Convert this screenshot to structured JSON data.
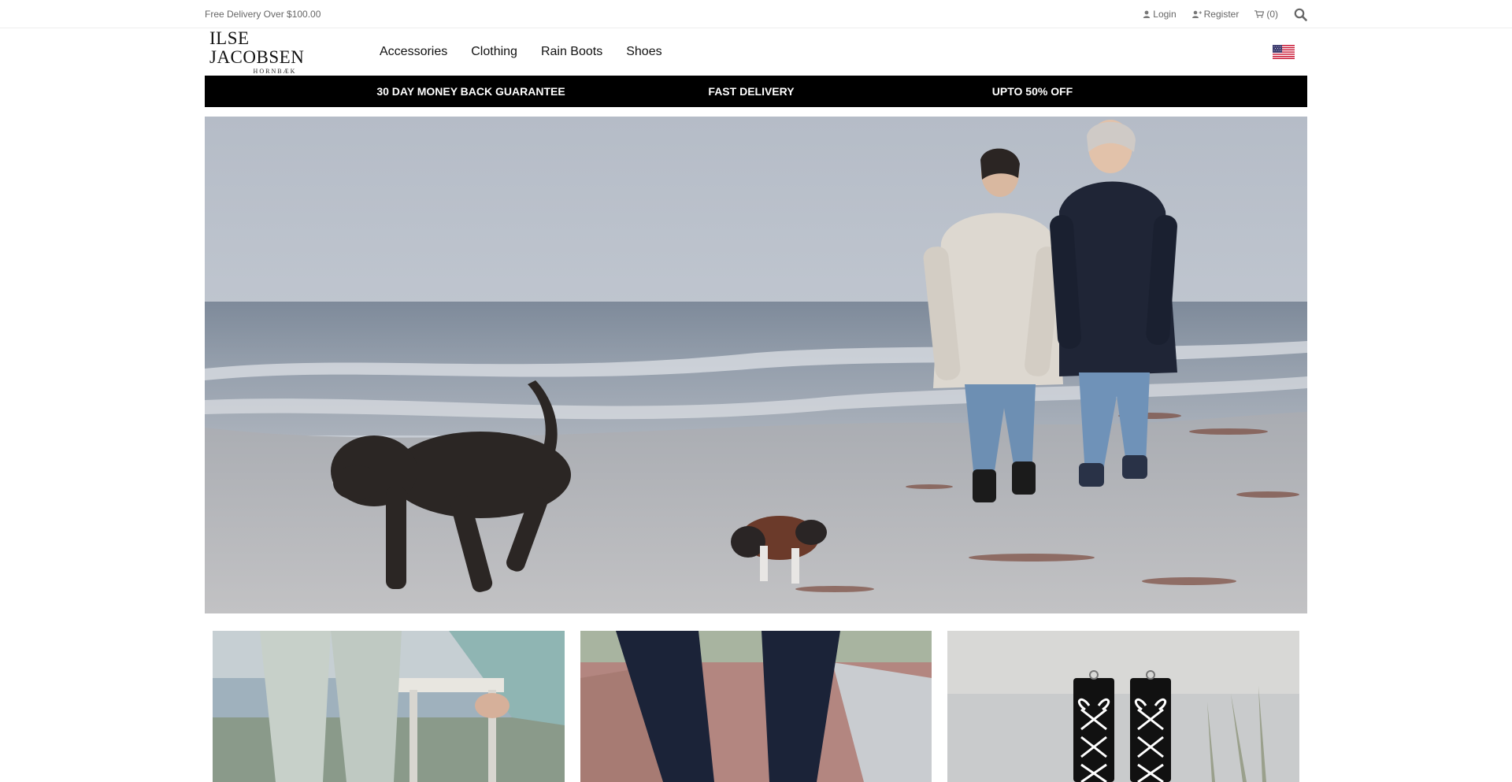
{
  "topbar": {
    "promo": "Free Delivery Over $100.00",
    "login": "Login",
    "register": "Register",
    "cart": "(0)"
  },
  "header": {
    "logo_main": "ILSE JACOBSEN",
    "logo_sub": "HORNBÆK",
    "nav": [
      "Accessories",
      "Clothing",
      "Rain Boots",
      "Shoes"
    ],
    "flag_icon": "us-flag-icon"
  },
  "benefits": [
    "30 DAY MONEY BACK GUARANTEE",
    "FAST DELIVERY",
    "UPTO 50% OFF"
  ],
  "colors": {
    "benefit_bar": "#000000",
    "topbar_text": "#666666"
  }
}
